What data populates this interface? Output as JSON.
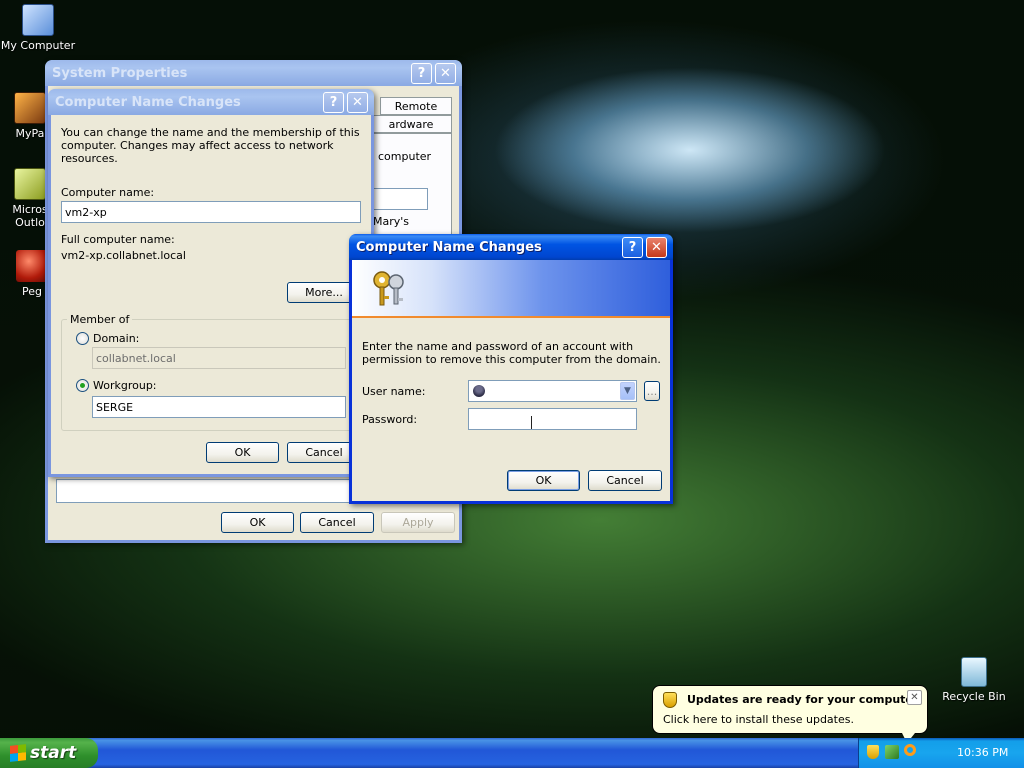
{
  "desktop": {
    "icons": [
      {
        "label": "My Computer",
        "icon": "my-computer-icon"
      },
      {
        "label": "MyPa",
        "icon": "mypack-icon"
      },
      {
        "label": "Micros",
        "label2": "Outlo",
        "icon": "outlook-icon"
      },
      {
        "label": "Peg",
        "icon": "pegasus-icon"
      },
      {
        "label": "Recycle Bin",
        "icon": "recycle-bin-icon"
      }
    ]
  },
  "system_properties": {
    "title": "System Properties",
    "tab_remote": "Remote",
    "tab_hardware": "ardware",
    "partial_text_computer": "computer",
    "partial_text_marys": "Mary's",
    "ok": "OK",
    "cancel": "Cancel",
    "apply": "Apply"
  },
  "name_changes": {
    "title": "Computer Name Changes",
    "description": "You can change the name and the membership of this computer. Changes may affect access to network resources.",
    "computer_name_label": "Computer name:",
    "computer_name_value": "vm2-xp",
    "full_name_label": "Full computer name:",
    "full_name_value": "vm2-xp.collabnet.local",
    "more_button": "More...",
    "member_of_label": "Member of",
    "domain_label": "Domain:",
    "domain_value": "collabnet.local",
    "workgroup_label": "Workgroup:",
    "workgroup_value": "SERGE",
    "selected_membership": "Workgroup",
    "ok": "OK",
    "cancel": "Cancel"
  },
  "credentials": {
    "title": "Computer Name Changes",
    "message": "Enter the name and password of an account with permission to remove this computer from the domain.",
    "username_label": "User name:",
    "username_value": "",
    "password_label": "Password:",
    "password_value": "",
    "browse_button": "...",
    "ok": "OK",
    "cancel": "Cancel"
  },
  "balloon": {
    "title": "Updates are ready for your computer",
    "text": "Click here to install these updates."
  },
  "taskbar": {
    "start_label": "start",
    "clock": "10:36 PM"
  },
  "colors": {
    "title_active": "#0054e3",
    "title_inactive": "#8aa9e3",
    "dialog_face": "#ece9d8",
    "start_green": "#2e8f2b",
    "tray_blue": "#18a5ee",
    "balloon_bg": "#ffffe1"
  }
}
